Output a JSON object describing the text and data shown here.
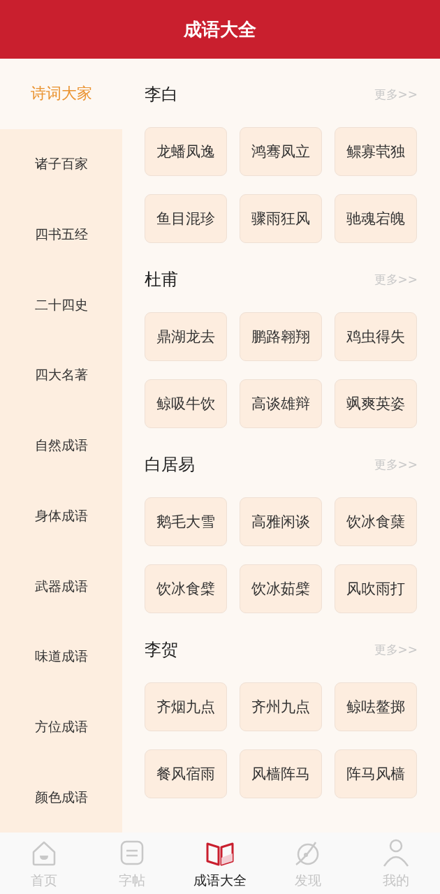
{
  "header": {
    "title": "成语大全"
  },
  "sidebar": {
    "items": [
      {
        "label": "诗词大家",
        "selected": true
      },
      {
        "label": "诸子百家",
        "selected": false
      },
      {
        "label": "四书五经",
        "selected": false
      },
      {
        "label": "二十四史",
        "selected": false
      },
      {
        "label": "四大名著",
        "selected": false
      },
      {
        "label": "自然成语",
        "selected": false
      },
      {
        "label": "身体成语",
        "selected": false
      },
      {
        "label": "武器成语",
        "selected": false
      },
      {
        "label": "味道成语",
        "selected": false
      },
      {
        "label": "方位成语",
        "selected": false
      },
      {
        "label": "颜色成语",
        "selected": false
      }
    ]
  },
  "sections": [
    {
      "title": "李白",
      "more": "更多>>",
      "idioms": [
        "龙蟠凤逸",
        "鸿骞凤立",
        "鳏寡茕独",
        "鱼目混珍",
        "骤雨狂风",
        "驰魂宕魄"
      ]
    },
    {
      "title": "杜甫",
      "more": "更多>>",
      "idioms": [
        "鼎湖龙去",
        "鹏路翱翔",
        "鸡虫得失",
        "鲸吸牛饮",
        "高谈雄辩",
        "飒爽英姿"
      ]
    },
    {
      "title": "白居易",
      "more": "更多>>",
      "idioms": [
        "鹅毛大雪",
        "高雅闲谈",
        "饮冰食蘖",
        "饮冰食檗",
        "饮冰茹檗",
        "风吹雨打"
      ]
    },
    {
      "title": "李贺",
      "more": "更多>>",
      "idioms": [
        "齐烟九点",
        "齐州九点",
        "鲸呿鳌掷",
        "餐风宿雨",
        "风樯阵马",
        "阵马风樯"
      ]
    }
  ],
  "tab_bar": {
    "tabs": [
      {
        "label": "首页",
        "selected": false
      },
      {
        "label": "字帖",
        "selected": false
      },
      {
        "label": "成语大全",
        "selected": true
      },
      {
        "label": "发现",
        "selected": false
      },
      {
        "label": "我的",
        "selected": false
      }
    ]
  }
}
